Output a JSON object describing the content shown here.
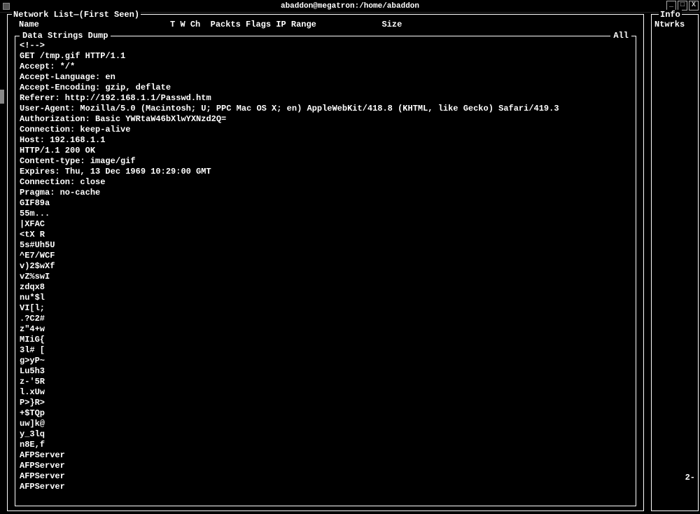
{
  "window": {
    "title": "abaddon@megatron:/home/abaddon"
  },
  "panels": {
    "main_title": "Network List—(First Seen)",
    "right_title": "Info",
    "right_line1": "Ntwrks",
    "dump_title": "Data Strings Dump",
    "dump_right": "All",
    "side_number": "2-"
  },
  "headers": {
    "row": "Name                          T W Ch  Packts Flags IP Range             Size"
  },
  "dump_lines": [
    "<!-->",
    "GET /tmp.gif HTTP/1.1",
    "Accept: */*",
    "Accept-Language: en",
    "Accept-Encoding: gzip, deflate",
    "Referer: http://192.168.1.1/Passwd.htm",
    "User-Agent: Mozilla/5.0 (Macintosh; U; PPC Mac OS X; en) AppleWebKit/418.8 (KHTML, like Gecko) Safari/419.3",
    "Authorization: Basic YWRtaW46bXlwYXNzd2Q=",
    "Connection: keep-alive",
    "Host: 192.168.1.1",
    "HTTP/1.1 200 OK",
    "Content-type: image/gif",
    "Expires: Thu, 13 Dec 1969 10:29:00 GMT",
    "Connection: close",
    "Pragma: no-cache",
    "GIF89a",
    "55m...",
    "|XFAC",
    "<tX R",
    "5s#Uh5U",
    "^E7/WCF",
    "v)2$wXf",
    "vZ%swI",
    "zdqx8",
    "nu*$l",
    "VI[l;",
    ".?C2#",
    "z\"4+w",
    "MIiG{",
    "3l# [",
    "g>yP~",
    "Lu5h3",
    "z-'5R",
    "l.xUw",
    "P>}R>",
    "+$TQp",
    "uw]k@",
    "y_3lq",
    "n8E,f",
    "AFPServer",
    "AFPServer",
    "AFPServer",
    "AFPServer"
  ]
}
